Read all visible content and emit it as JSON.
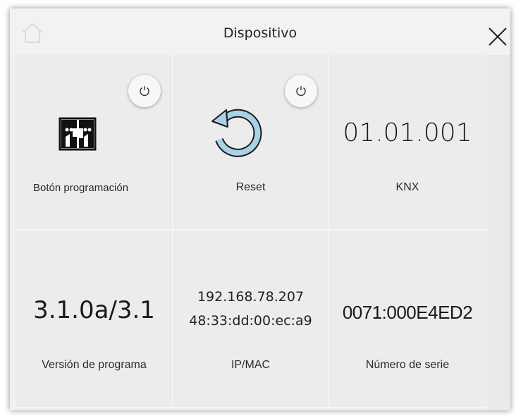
{
  "header": {
    "title": "Dispositivo",
    "home_icon": "home-icon",
    "close_icon": "close-icon"
  },
  "cells": {
    "prog": {
      "label": "Botón programación",
      "icon": "programming-button-icon",
      "action_icon": "power-icon"
    },
    "reset": {
      "label": "Reset",
      "icon": "reset-icon",
      "action_icon": "power-icon"
    },
    "knx": {
      "value": "01.01.001",
      "label": "KNX"
    },
    "version": {
      "value": "3.1.0a/3.1",
      "label": "Versión de programa"
    },
    "ipmac": {
      "ip": "192.168.78.207",
      "mac": "48:33:dd:00:ec:a9",
      "label": "IP/MAC"
    },
    "serial": {
      "value": "0071:000E4ED2",
      "label": "Número de serie"
    }
  },
  "colors": {
    "reset_icon_fill": "#a8d2e8",
    "reset_icon_stroke": "#1a1a1a",
    "cell_bg": "#ececec"
  }
}
